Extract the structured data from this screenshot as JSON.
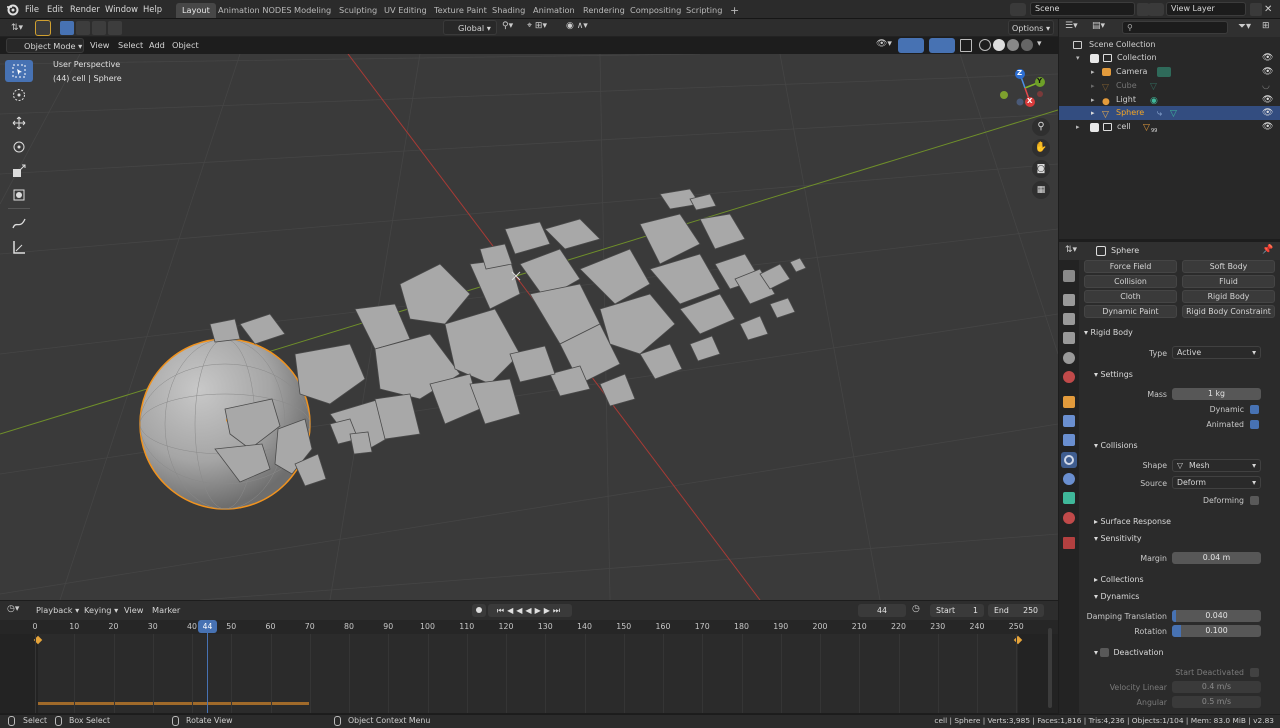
{
  "menus": [
    "File",
    "Edit",
    "Render",
    "Window",
    "Help"
  ],
  "workspace_tabs": [
    "Layout",
    "Animation NODES",
    "Modeling",
    "Sculpting",
    "UV Editing",
    "Texture Paint",
    "Shading",
    "Animation",
    "Rendering",
    "Compositing",
    "Scripting"
  ],
  "scene_name": "Scene",
  "view_layer_name": "View Layer",
  "viewport": {
    "mode": "Object Mode",
    "menus": [
      "View",
      "Select",
      "Add",
      "Object"
    ],
    "transform_orientation": "Global",
    "options_label": "Options",
    "perspective_label": "User Perspective",
    "context_label": "(44) cell | Sphere",
    "gizmo_axes": [
      "Z",
      "Y",
      "X"
    ]
  },
  "outliner": {
    "root": "Scene Collection",
    "items": [
      {
        "label": "Collection"
      },
      {
        "label": "Camera"
      },
      {
        "label": "Cube"
      },
      {
        "label": "Light"
      },
      {
        "label": "Sphere"
      },
      {
        "label": "cell"
      }
    ],
    "cell_badge": "99"
  },
  "properties": {
    "object_name": "Sphere",
    "physics_buttons": [
      [
        "Force Field",
        "Soft Body"
      ],
      [
        "Collision",
        "Fluid"
      ],
      [
        "Cloth",
        "Rigid Body"
      ],
      [
        "Dynamic Paint",
        "Rigid Body Constraint"
      ]
    ],
    "rigid_body_header": "Rigid Body",
    "type_label": "Type",
    "type_value": "Active",
    "settings_header": "Settings",
    "mass_label": "Mass",
    "mass_value": "1 kg",
    "dynamic_label": "Dynamic",
    "animated_label": "Animated",
    "collisions_header": "Collisions",
    "shape_label": "Shape",
    "shape_value": "Mesh",
    "source_label": "Source",
    "source_value": "Deform",
    "deforming_label": "Deforming",
    "surface_response_header": "Surface Response",
    "sensitivity_header": "Sensitivity",
    "margin_label": "Margin",
    "margin_value": "0.04 m",
    "collections_header": "Collections",
    "dynamics_header": "Dynamics",
    "damping_translation_label": "Damping Translation",
    "damping_translation_value": "0.040",
    "rotation_label": "Rotation",
    "rotation_value": "0.100",
    "rotation_fill": 0.1,
    "damping_fill": 0.04,
    "deactivation_header": "Deactivation",
    "start_deactivated_label": "Start Deactivated",
    "velocity_linear_label": "Velocity Linear",
    "velocity_linear_value": "0.4 m/s",
    "angular_label": "Angular",
    "angular_value": "0.5 m/s"
  },
  "timeline": {
    "menus": [
      "Playback",
      "Keying",
      "View",
      "Marker"
    ],
    "current_frame": "44",
    "start_label": "Start",
    "start_value": "1",
    "end_label": "End",
    "end_value": "250",
    "ticks": [
      "0",
      "10",
      "20",
      "30",
      "40",
      "44",
      "50",
      "60",
      "70",
      "80",
      "90",
      "100",
      "110",
      "120",
      "130",
      "140",
      "150",
      "160",
      "170",
      "180",
      "190",
      "200",
      "210",
      "220",
      "230",
      "240",
      "250"
    ]
  },
  "statusbar": {
    "select": "Select",
    "box_select": "Box Select",
    "rotate_view": "Rotate View",
    "context_menu": "Object Context Menu",
    "stats": "cell | Sphere | Verts:3,985 | Faces:1,816 | Tris:4,236 | Objects:1/104 | Mem: 83.0 MiB | v2.83"
  },
  "colors": {
    "accent_blue": "#4772b3",
    "selection_orange": "#f0931f",
    "axis_red": "#c9473e",
    "axis_green": "#7ea02e"
  }
}
